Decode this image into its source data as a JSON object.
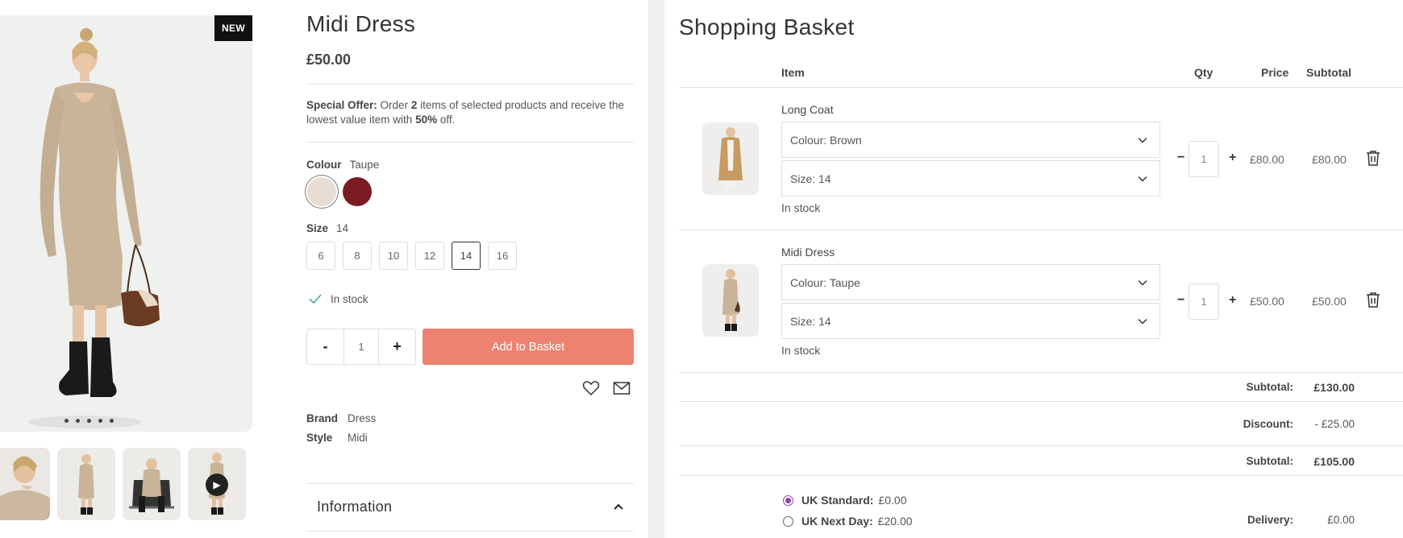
{
  "product": {
    "badge": "NEW",
    "title": "Midi Dress",
    "price": "£50.00",
    "offer": {
      "label": "Special Offer:",
      "text_1": "Order",
      "count": "2",
      "text_2": "items of selected products and receive the lowest value item with",
      "discount": "50%",
      "text_3": "off."
    },
    "colour": {
      "label": "Colour",
      "selected": "Taupe",
      "swatches": [
        "#e8ddd4",
        "#7a1b22"
      ]
    },
    "size": {
      "label": "Size",
      "selected": "14",
      "options": [
        "6",
        "8",
        "10",
        "12",
        "14",
        "16"
      ]
    },
    "stock": "In stock",
    "quantity": {
      "minus": "-",
      "value": "1",
      "plus": "+"
    },
    "add_to_basket": "Add to Basket",
    "specs": [
      {
        "label": "Brand",
        "value": "Dress"
      },
      {
        "label": "Style",
        "value": "Midi"
      }
    ],
    "information": "Information",
    "image_count": 5
  },
  "basket": {
    "title": "Shopping Basket",
    "headers": {
      "item": "Item",
      "qty": "Qty",
      "price": "Price",
      "subtotal": "Subtotal"
    },
    "items": [
      {
        "name": "Long Coat",
        "colour": "Colour:  Brown",
        "size": "Size:  14",
        "stock": "In stock",
        "qty": "1",
        "minus": "−",
        "plus": "+",
        "price": "£80.00",
        "subtotal": "£80.00"
      },
      {
        "name": "Midi Dress",
        "colour": "Colour:  Taupe",
        "size": "Size:  14",
        "stock": "In stock",
        "qty": "1",
        "minus": "−",
        "plus": "+",
        "price": "£50.00",
        "subtotal": "£50.00"
      }
    ],
    "summary": {
      "subtotal_label": "Subtotal:",
      "subtotal": "£130.00",
      "discount_label": "Discount:",
      "discount": "- £25.00",
      "subtotal2_label": "Subtotal:",
      "subtotal2": "£105.00",
      "delivery_label": "Delivery:",
      "delivery": "£0.00"
    },
    "delivery_options": [
      {
        "name": "UK Standard:",
        "price": "£0.00",
        "checked": true
      },
      {
        "name": "UK Next Day:",
        "price": "£20.00",
        "checked": false
      }
    ],
    "accent": "#8e44ad"
  }
}
